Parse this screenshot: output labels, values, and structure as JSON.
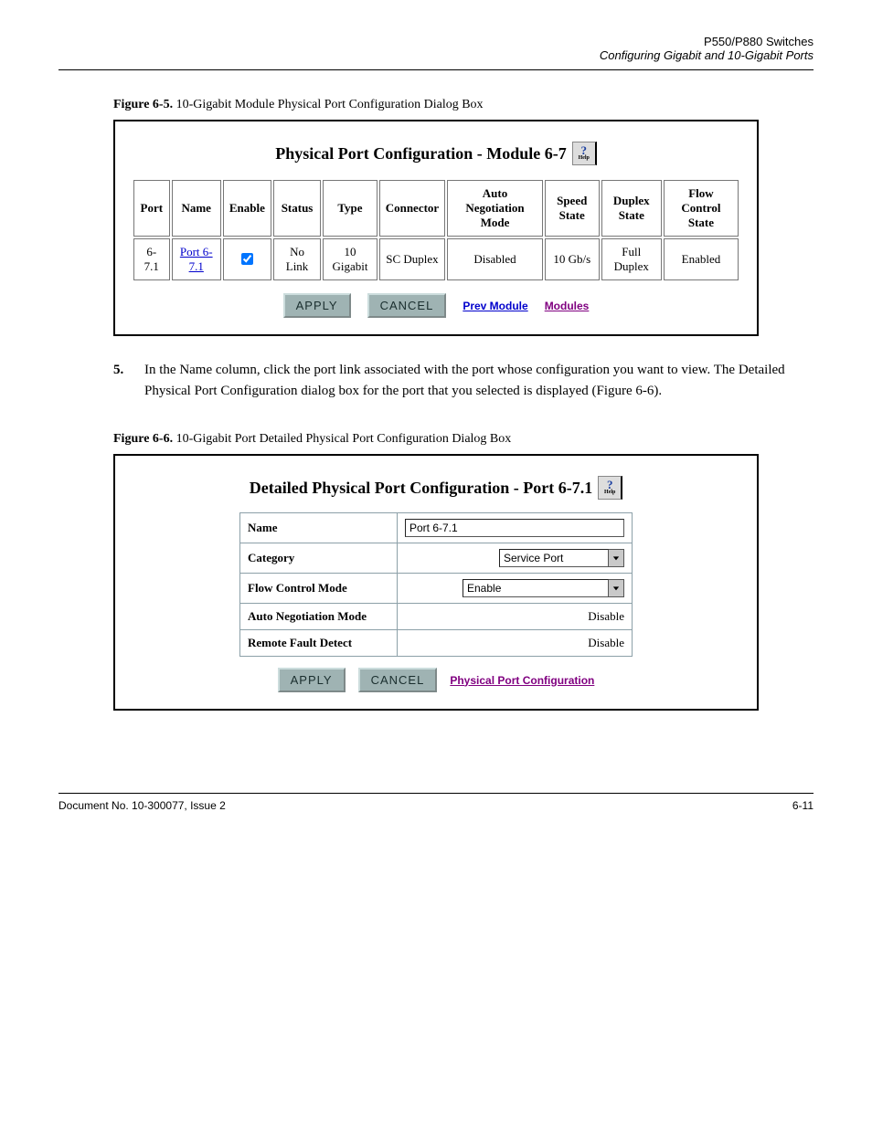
{
  "header": {
    "product": "P550/P880 Switches",
    "section_title": "Configuring Gigabit and 10-Gigabit Ports"
  },
  "figure_a": {
    "label_prefix": "Figure 6-5.",
    "label_text": "10-Gigabit Module Physical Port Configuration Dialog Box"
  },
  "panel_a": {
    "title": "Physical Port Configuration - Module 6-7",
    "help_label": "Help",
    "columns": [
      "Port",
      "Name",
      "Enable",
      "Status",
      "Type",
      "Connector",
      "Auto Negotiation Mode",
      "Speed State",
      "Duplex State",
      "Flow Control State"
    ],
    "row": {
      "port": "6-7.1",
      "name": "Port 6-7.1",
      "enable_checked": true,
      "status": "No Link",
      "type": "10 Gigabit",
      "connector": "SC Duplex",
      "autoneg": "Disabled",
      "speed": "10 Gb/s",
      "duplex": "Full Duplex",
      "flow": "Enabled"
    },
    "buttons": {
      "apply": "APPLY",
      "cancel": "CANCEL",
      "prev": "Prev Module",
      "modules": "Modules"
    }
  },
  "steps": {
    "s5_num": "5.",
    "s5_text": "In the Name column, click the port link associated with the port whose configuration you want to view. The Detailed Physical Port Configuration dialog box for the port that you selected is displayed (Figure 6-6)."
  },
  "figure_b": {
    "label_prefix": "Figure 6-6.",
    "label_text": "10-Gigabit Port Detailed Physical Port Configuration Dialog Box"
  },
  "panel_b": {
    "title": "Detailed Physical Port Configuration - Port 6-7.1",
    "help_label": "Help",
    "rows": {
      "name_lab": "Name",
      "name_val": "Port 6-7.1",
      "cat_lab": "Category",
      "cat_val": "Service Port",
      "flow_lab": "Flow Control Mode",
      "flow_val": "Enable",
      "autoneg_lab": "Auto Negotiation Mode",
      "autoneg_val": "Disable",
      "remote_lab": "Remote Fault Detect",
      "remote_val": "Disable"
    },
    "buttons": {
      "apply": "APPLY",
      "cancel": "CANCEL",
      "back": "Physical Port Configuration"
    }
  },
  "footer": {
    "doc_number": "Document No. 10-300077, Issue 2",
    "page": "6-11"
  }
}
